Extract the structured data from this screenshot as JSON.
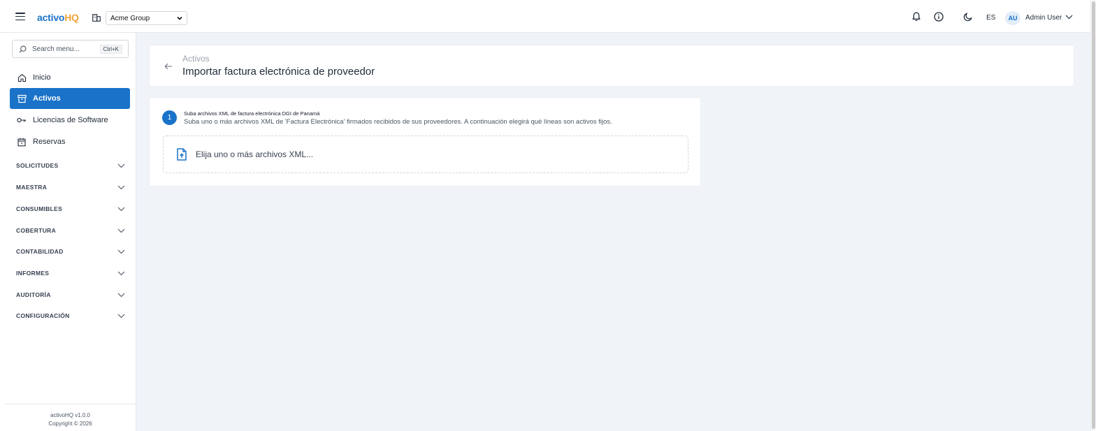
{
  "app": {
    "logo_part1": "activo",
    "logo_part2": "HQ",
    "org_selected": "Acme Group"
  },
  "topbar": {
    "language": "ES",
    "avatar_initials": "AU",
    "user_name": "Admin User"
  },
  "sidebar": {
    "search_placeholder": "Search menu...",
    "search_shortcut": "Ctrl+K",
    "items": [
      {
        "label": "Inicio",
        "icon": "home-icon"
      },
      {
        "label": "Activos",
        "icon": "archive-icon",
        "active": true
      },
      {
        "label": "Licencias de Software",
        "icon": "key-icon"
      },
      {
        "label": "Reservas",
        "icon": "calendar-icon"
      }
    ],
    "sections": [
      "SOLICITUDES",
      "MAESTRA",
      "CONSUMIBLES",
      "COBERTURA",
      "CONTABILIDAD",
      "INFORMES",
      "AUDITORÍA",
      "CONFIGURACIÓN"
    ],
    "footer_version": "activoHQ v1.0.0",
    "footer_copyright": "Copyright © 2026"
  },
  "header": {
    "breadcrumb": "Activos",
    "title": "Importar factura electrónica de proveedor"
  },
  "step": {
    "number": "1",
    "title": "Suba archivos XML de factura electrónica DGI de Panamá",
    "description": "Suba uno o más archivos XML de 'Factura Electrónica' firmados recibidos de sus proveedores. A continuación elegirá qué líneas son activos fijos.",
    "dropzone_label": "Elija uno o más archivos XML..."
  },
  "colors": {
    "accent": "#1a73c9",
    "logo_secondary": "#f2a33a",
    "background": "#f0f3f8"
  }
}
